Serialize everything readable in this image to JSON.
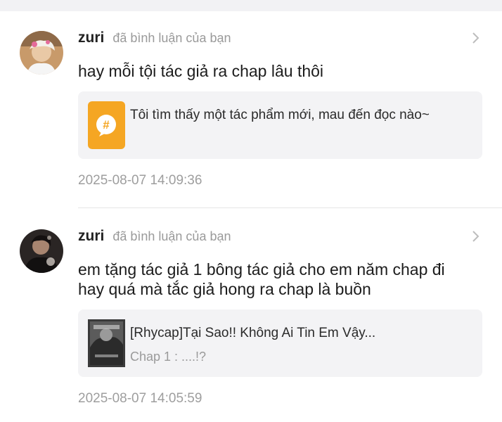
{
  "notifications": [
    {
      "user": "zuri",
      "action": "đã bình luận của bạn",
      "comment": "hay mỗi tội tác giả ra chap lâu thôi",
      "card": {
        "icon": "hashtag-icon",
        "title": "Tôi tìm thấy một tác phẩm mới, mau đến đọc nào~",
        "subtitle": ""
      },
      "timestamp": "2025-08-07 14:09:36"
    },
    {
      "user": "zuri",
      "action": "đã bình luận của bạn",
      "comment_lines": [
        "em tặng tác giả 1 bông tác giả cho em năm chap đi",
        "hay quá mà tắc giả hong ra chap là buồn"
      ],
      "card": {
        "icon": "comic-cover-thumbnail",
        "title": "[Rhycap]Tại Sao!! Không Ai Tin Em Vậy...",
        "subtitle": "Chap 1 : ....!?"
      },
      "timestamp": "2025-08-07 14:05:59"
    }
  ],
  "colors": {
    "accent_orange": "#f5a623",
    "card_bg": "#f3f3f5",
    "muted_text": "#9a9a9a"
  }
}
